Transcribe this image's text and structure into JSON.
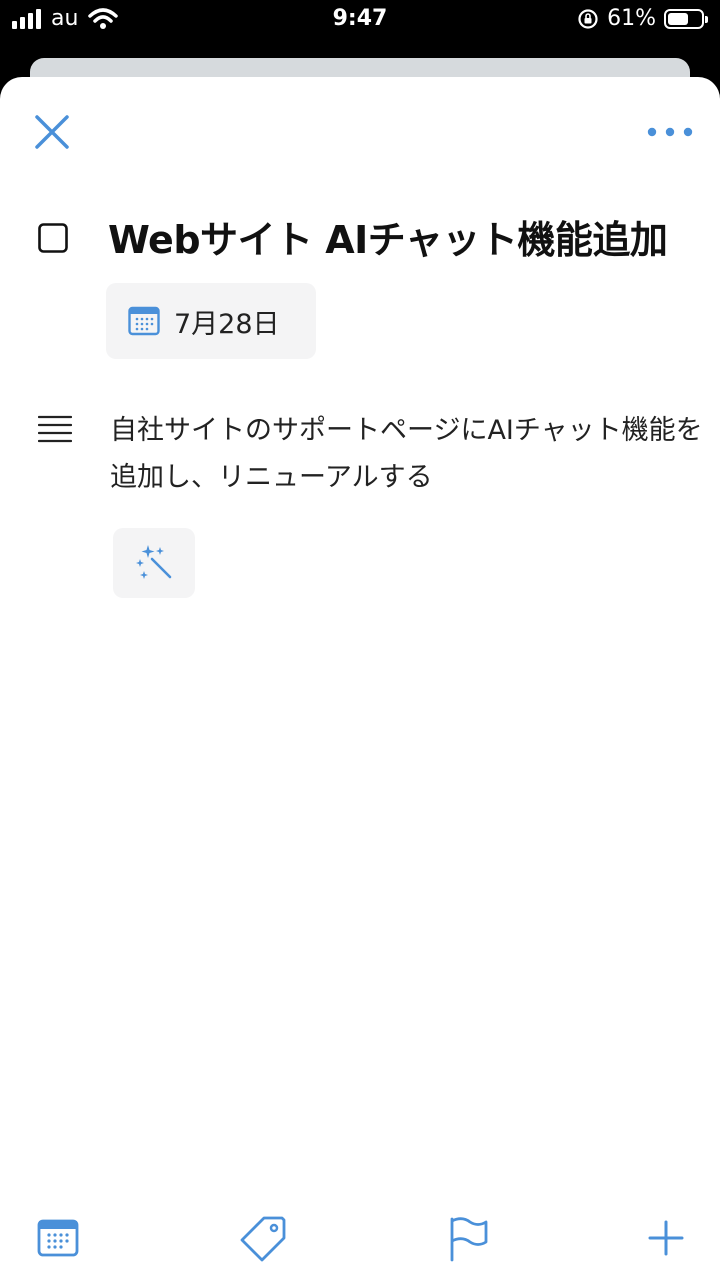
{
  "status_bar": {
    "carrier": "au",
    "time": "9:47",
    "battery_percent_label": "61%",
    "battery_level": 0.61
  },
  "task": {
    "title": "Webサイト AIチャット機能追加",
    "due_date": "7月28日",
    "notes": "自社サイトのサポートページにAIチャット機能を追加し、リニューアルする"
  },
  "icons": {
    "close": "close-icon",
    "more": "more-horizontal-icon",
    "checkbox": "checkbox-icon",
    "calendar": "calendar-icon",
    "notes": "notes-lines-icon",
    "ai": "magic-wand-icon",
    "toolbar": [
      "calendar-icon",
      "tag-icon",
      "flag-icon",
      "plus-icon"
    ]
  },
  "colors": {
    "accent": "#4a90d9",
    "chip_bg": "#f4f4f5",
    "text": "#111111"
  }
}
